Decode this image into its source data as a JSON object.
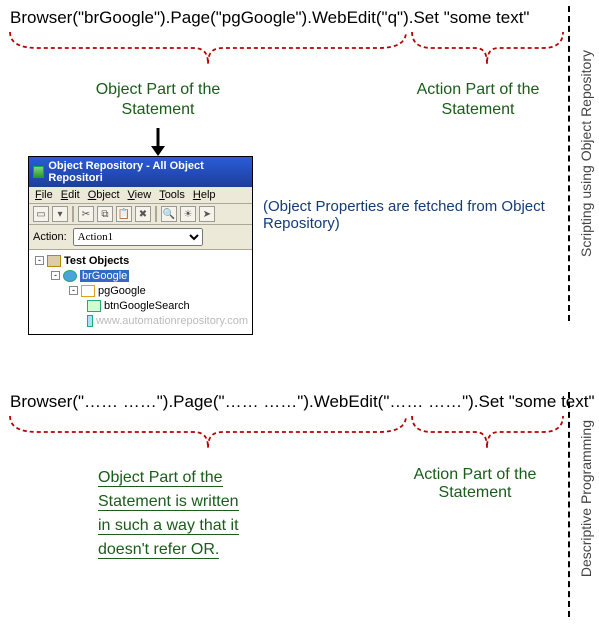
{
  "code_top": "Browser(\"brGoogle\").Page(\"pgGoogle\").WebEdit(\"q\").Set \"some text\"",
  "code_bot": "Browser(\"…… ……\").Page(\"…… ……\").WebEdit(\"…… ……\").Set \"some text\"",
  "ann": {
    "top_left": "Object Part of the Statement",
    "top_right": "Action Part of the Statement",
    "mid": "(Object Properties are fetched from Object Repository)",
    "bot_left_l1": "Object Part of the",
    "bot_left_l2": "Statement is written",
    "bot_left_l3": "in such a way that it",
    "bot_left_l4": "doesn't refer OR.",
    "bot_right": "Action Part of the Statement"
  },
  "side": {
    "top": "Scripting using Object Repository",
    "bot": "Descriptive Programming"
  },
  "orwin": {
    "title": "Object Repository - All Object Repositori",
    "menus": [
      "File",
      "Edit",
      "Object",
      "View",
      "Tools",
      "Help"
    ],
    "action_label": "Action:",
    "action_value": "Action1",
    "root": "Test Objects",
    "n_browser": "brGoogle",
    "n_page": "pgGoogle",
    "n_button": "btnGoogleSearch",
    "watermark": "www.automationrepository.com"
  }
}
